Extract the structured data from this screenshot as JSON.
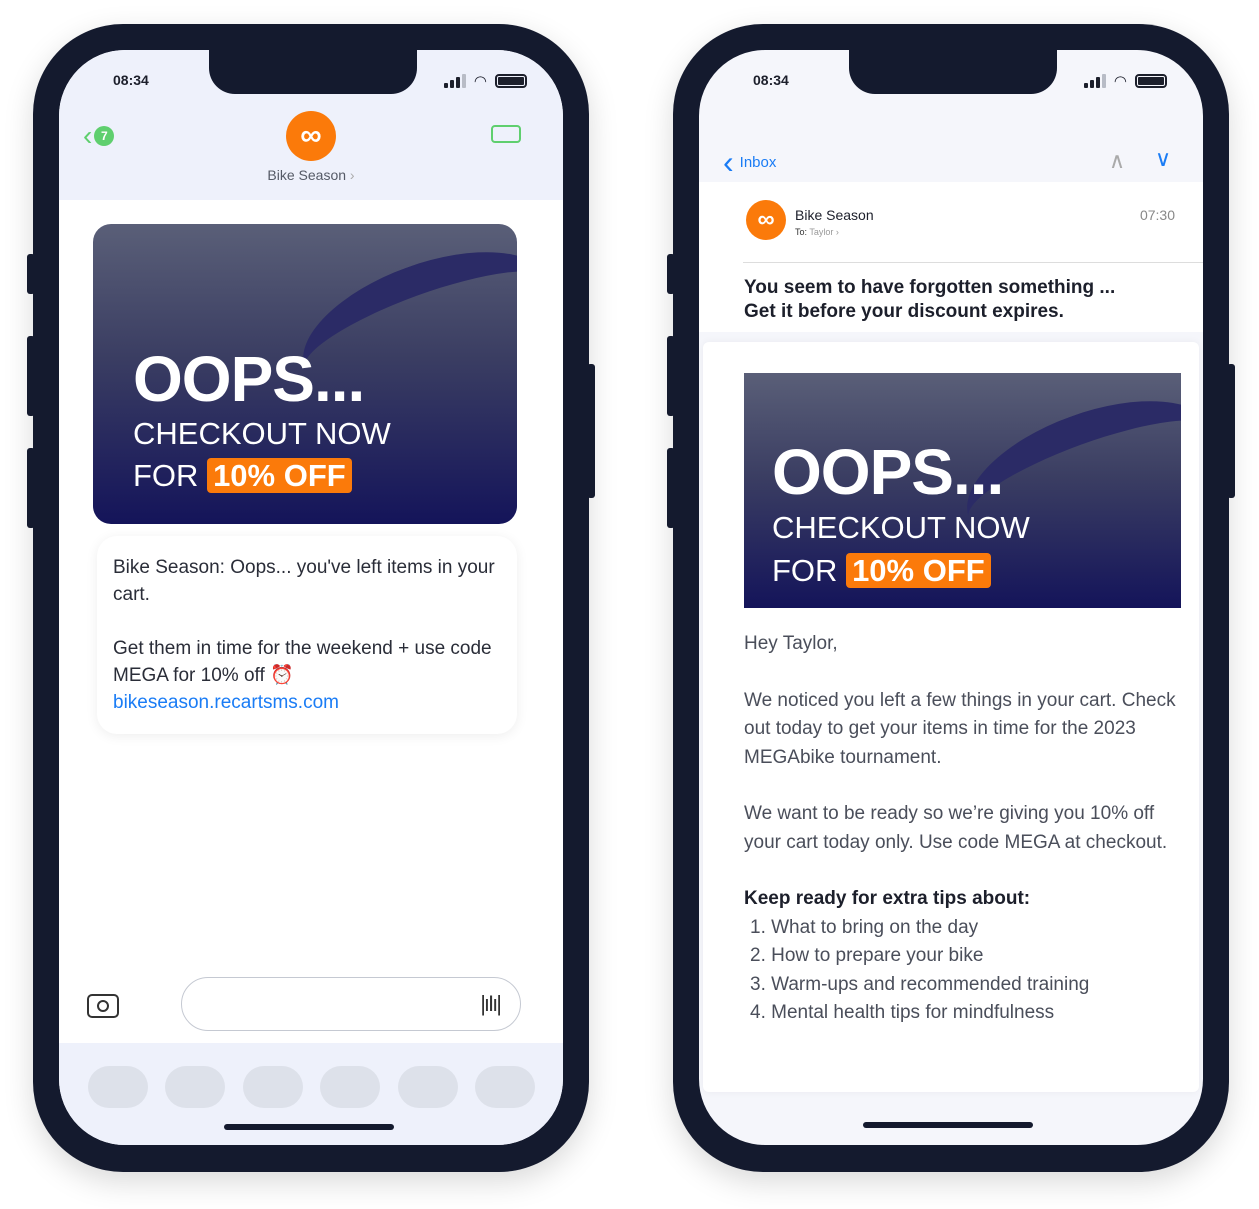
{
  "sms_phone": {
    "time": "08:34",
    "back_badge": "7",
    "contact_name": "Bike Season",
    "banner": {
      "headline": "OOPS...",
      "line1": "CHECKOUT NOW",
      "line2_prefix": "FOR",
      "discount": "10% OFF"
    },
    "message": {
      "para1": "Bike Season: Oops... you've left items in your cart.",
      "para2": "Get them in time for the weekend + use code MEGA for 10% off ⏰",
      "link": "bikeseason.recartsms.com"
    },
    "input_placeholder": ""
  },
  "email_phone": {
    "time": "08:34",
    "back_label": "Inbox",
    "sender": "Bike Season",
    "to_label": "To:",
    "to_name": "Taylor",
    "received_time": "07:30",
    "subject_line1": "You seem to have forgotten something ...",
    "subject_line2": "Get it before your discount expires.",
    "banner": {
      "headline": "OOPS...",
      "line1": "CHECKOUT NOW",
      "line2_prefix": "FOR",
      "discount": "10% OFF"
    },
    "greeting": "Hey Taylor,",
    "para1": "We noticed you left a few things in your cart. Check out today to get your items in time for the 2023 MEGAbike tournament.",
    "para2": "We want to be ready so we’re giving you 10% off your cart today only. Use code MEGA at checkout.",
    "tips_heading": "Keep ready for extra tips about:",
    "tips": [
      "1. What to bring on the day",
      "2. How to prepare your bike",
      "3. Warm-ups and recommended training",
      "4. Mental health tips for mindfulness"
    ]
  },
  "colors": {
    "brand": "#fb7a0a",
    "frame": "#141a2e",
    "ios_green": "#5fcf6e",
    "ios_blue": "#1a7cf5",
    "link": "#1a7cf5"
  }
}
